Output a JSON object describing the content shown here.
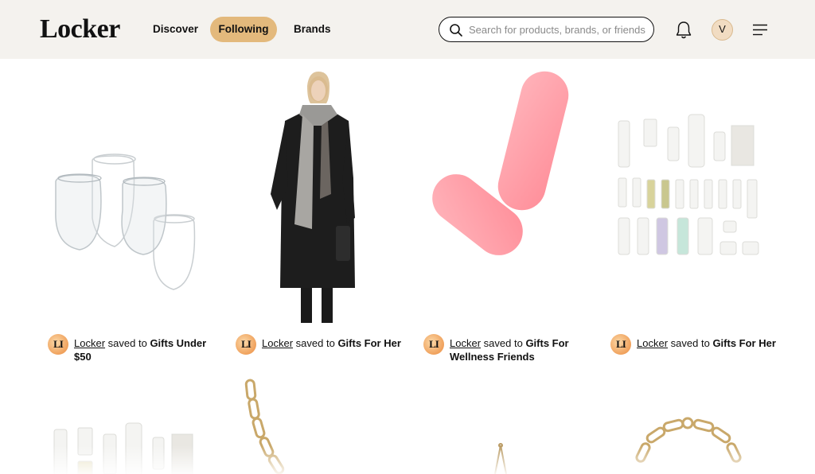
{
  "header": {
    "logo": "Locker",
    "nav": [
      {
        "label": "Discover"
      },
      {
        "label": "Following",
        "active": true
      },
      {
        "label": "Brands"
      }
    ],
    "search": {
      "placeholder": "Search for products, brands, or friends",
      "value": ""
    },
    "avatar_initial": "V",
    "icons": [
      "search-icon",
      "bell-icon",
      "menu-icon"
    ]
  },
  "feed": [
    {
      "badge": "LI",
      "user": "Locker",
      "verb": "saved to",
      "board": "Gifts Under $50",
      "image": "stemless-wine-glasses"
    },
    {
      "badge": "LI",
      "user": "Locker",
      "verb": "saved to",
      "board": "Gifts For Her",
      "image": "black-coat-grey-scarf"
    },
    {
      "badge": "LI",
      "user": "Locker",
      "verb": "saved to",
      "board": "Gifts For Wellness Friends",
      "image": "pink-massage-rollers"
    },
    {
      "badge": "LI",
      "user": "Locker",
      "verb": "saved to",
      "board": "Gifts For Her",
      "image": "skincare-set"
    }
  ],
  "colors": {
    "header_bg": "#f4f2ee",
    "active_pill": "#e3b97c",
    "avatar_bg": "#f1dcc2"
  }
}
